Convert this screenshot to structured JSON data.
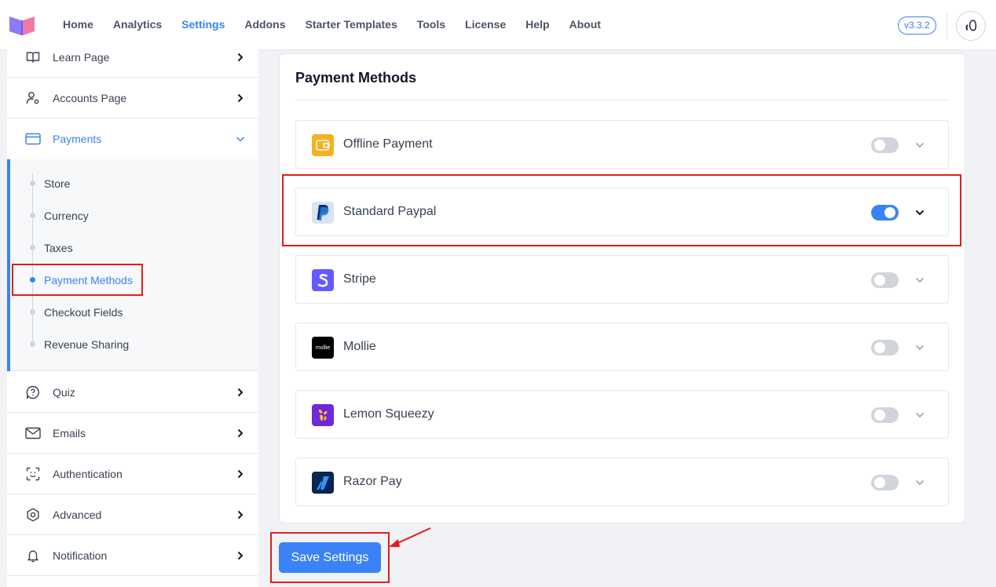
{
  "header": {
    "nav": [
      {
        "label": "Home",
        "active": false
      },
      {
        "label": "Analytics",
        "active": false
      },
      {
        "label": "Settings",
        "active": true
      },
      {
        "label": "Addons",
        "active": false
      },
      {
        "label": "Starter Templates",
        "active": false
      },
      {
        "label": "Tools",
        "active": false
      },
      {
        "label": "License",
        "active": false
      },
      {
        "label": "Help",
        "active": false
      },
      {
        "label": "About",
        "active": false
      }
    ],
    "version": "v3.3.2"
  },
  "sidebar": {
    "items": [
      {
        "label": "Learn Page",
        "icon": "book-icon"
      },
      {
        "label": "Accounts Page",
        "icon": "user-gear-icon"
      },
      {
        "label": "Payments",
        "icon": "card-icon",
        "open": true
      },
      {
        "label": "Quiz",
        "icon": "quiz-icon"
      },
      {
        "label": "Emails",
        "icon": "mail-icon"
      },
      {
        "label": "Authentication",
        "icon": "scan-face-icon"
      },
      {
        "label": "Advanced",
        "icon": "hexagon-icon"
      },
      {
        "label": "Notification",
        "icon": "bell-icon"
      }
    ],
    "payments_sub": [
      {
        "label": "Store",
        "active": false
      },
      {
        "label": "Currency",
        "active": false
      },
      {
        "label": "Taxes",
        "active": false
      },
      {
        "label": "Payment Methods",
        "active": true
      },
      {
        "label": "Checkout Fields",
        "active": false
      },
      {
        "label": "Revenue Sharing",
        "active": false
      }
    ]
  },
  "main": {
    "title": "Payment Methods",
    "methods": [
      {
        "name": "Offline Payment",
        "enabled": false,
        "icon": "wallet-icon"
      },
      {
        "name": "Standard Paypal",
        "enabled": true,
        "icon": "paypal-icon"
      },
      {
        "name": "Stripe",
        "enabled": false,
        "icon": "stripe-icon"
      },
      {
        "name": "Mollie",
        "enabled": false,
        "icon": "mollie-icon",
        "logo_text": "mollie"
      },
      {
        "name": "Lemon Squeezy",
        "enabled": false,
        "icon": "lemon-squeezy-icon"
      },
      {
        "name": "Razor Pay",
        "enabled": false,
        "icon": "razorpay-icon"
      }
    ],
    "save_label": "Save Settings"
  },
  "colors": {
    "accent": "#3b82f6",
    "annotation": "#e11d1d"
  }
}
